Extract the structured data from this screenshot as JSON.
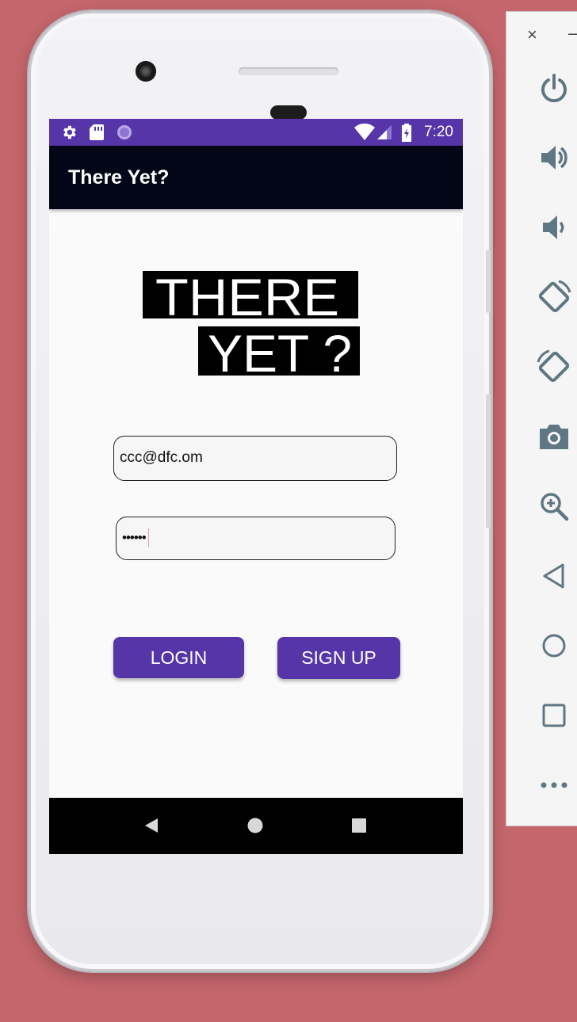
{
  "statusbar": {
    "time": "7:20",
    "icons": [
      "settings-icon",
      "sd-card-icon",
      "circle-notification-icon",
      "wifi-icon",
      "signal-icon",
      "battery-icon"
    ]
  },
  "appbar": {
    "title": "There Yet?"
  },
  "logo": {
    "line1": "THERE",
    "line2": "YET ?"
  },
  "form": {
    "email_value": "ccc@dfc.om",
    "password_value": "••••••"
  },
  "buttons": {
    "login": "LOGIN",
    "signup": "SIGN UP"
  },
  "navbar": {
    "icons": [
      "back-icon",
      "home-icon",
      "recents-icon"
    ]
  },
  "emulator": {
    "close": "×",
    "minimize": "–",
    "tools": [
      "power-icon",
      "volume-up-icon",
      "volume-down-icon",
      "rotate-left-icon",
      "rotate-right-icon",
      "camera-icon",
      "zoom-icon",
      "back-icon",
      "home-icon",
      "overview-icon",
      "more-icon"
    ]
  },
  "colors": {
    "primary": "#5535a7",
    "appbar": "#020616",
    "background": "#c4666c"
  }
}
